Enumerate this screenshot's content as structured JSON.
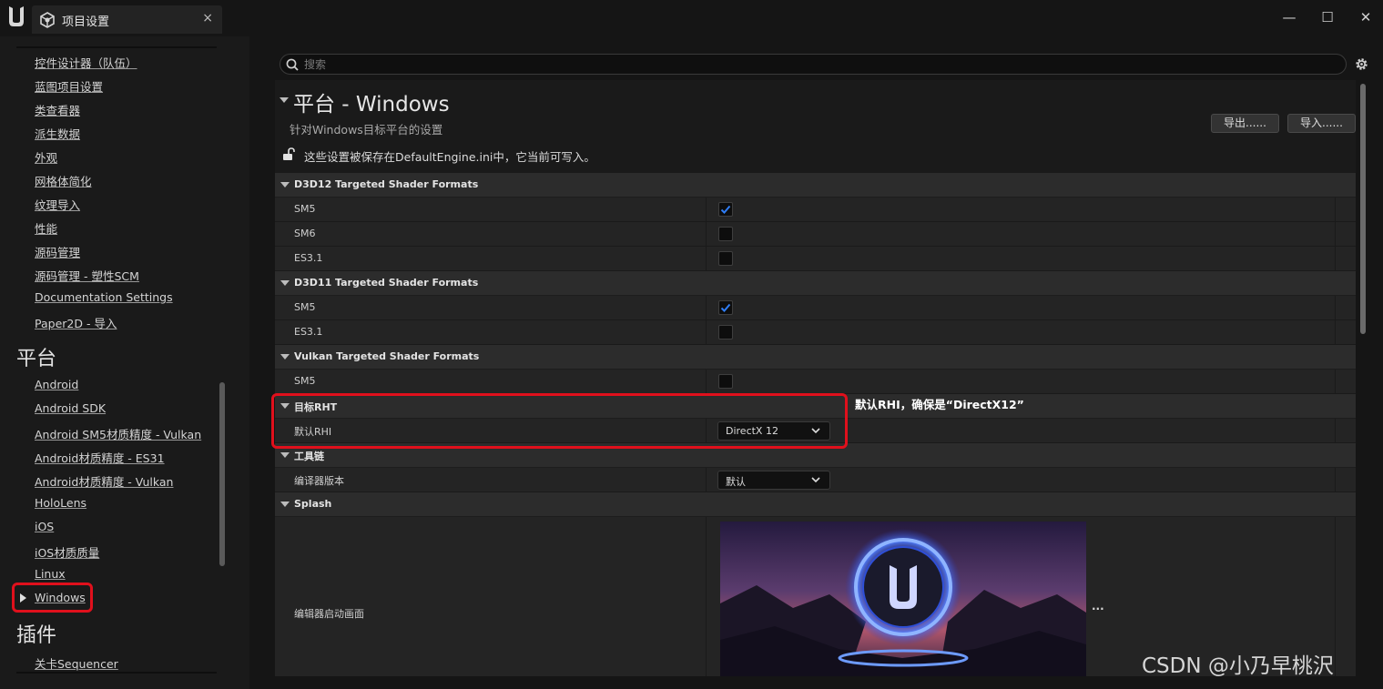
{
  "window": {
    "tab_title": "项目设置",
    "tab_close": "×",
    "minimize": "—",
    "maximize": "☐",
    "close": "✕"
  },
  "sidebar": {
    "items_top": [
      "控件设计器（队伍）",
      "蓝图项目设置",
      "类查看器",
      "派生数据",
      "外观",
      "网格体简化",
      "纹理导入",
      "性能",
      "源码管理",
      "源码管理 - 塑性SCM",
      "Documentation Settings",
      "Paper2D - 导入"
    ],
    "section_platform": "平台",
    "items_platform": [
      "Android",
      "Android SDK",
      "Android SM5材质精度 - Vulkan",
      "Android材质精度 - ES31",
      "Android材质精度 - Vulkan",
      "HoloLens",
      "iOS",
      "iOS材质质量",
      "Linux",
      "Windows"
    ],
    "section_plugins": "插件",
    "items_plugins": [
      "关卡Sequencer"
    ]
  },
  "search": {
    "placeholder": "搜索",
    "value": ""
  },
  "header": {
    "title": "平台 - Windows",
    "subtitle": "针对Windows目标平台的设置",
    "note": "这些设置被保存在DefaultEngine.ini中，它当前可写入。",
    "export_label": "导出......",
    "import_label": "导入......"
  },
  "sections": [
    {
      "title": "D3D12 Targeted Shader Formats",
      "props": [
        {
          "label": "SM5",
          "checked": true
        },
        {
          "label": "SM6",
          "checked": false
        },
        {
          "label": "ES3.1",
          "checked": false
        }
      ]
    },
    {
      "title": "D3D11 Targeted Shader Formats",
      "props": [
        {
          "label": "SM5",
          "checked": true
        },
        {
          "label": "ES3.1",
          "checked": false
        }
      ]
    },
    {
      "title": "Vulkan Targeted Shader Formats",
      "props": [
        {
          "label": "SM5",
          "checked": false
        }
      ]
    }
  ],
  "rhi": {
    "title": "目标RHT",
    "label": "默认RHI",
    "value": "DirectX 12"
  },
  "toolchain": {
    "title": "工具链",
    "label": "编译器版本",
    "value": "默认"
  },
  "splash": {
    "title": "Splash",
    "label": "编辑器启动画面",
    "more": "···"
  },
  "annotation": "默认RHI，确保是“DirectX12”",
  "watermark": "CSDN @小乃早桃沢",
  "colors": {
    "accent_check": "#2f7df6",
    "highlight_red": "#e0101c"
  }
}
